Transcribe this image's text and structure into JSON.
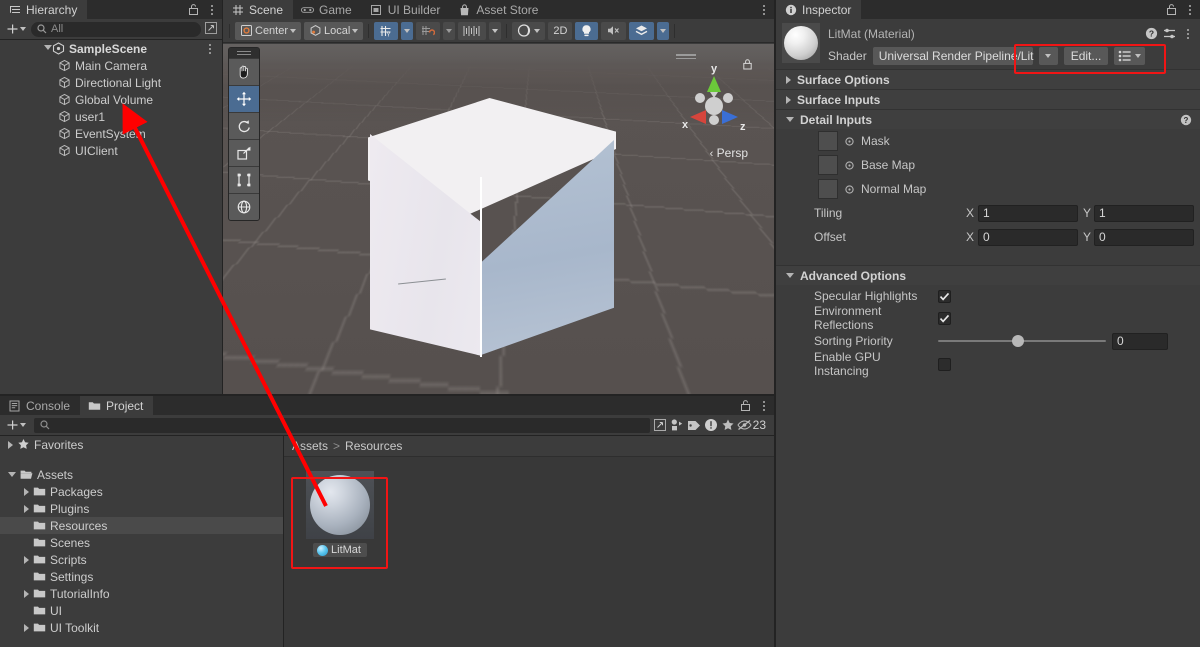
{
  "app": {
    "name": "Unity Editor"
  },
  "hierarchy": {
    "tab_label": "Hierarchy",
    "tab_icon": "hierarchy-icon",
    "add_label": "+",
    "search_placeholder": "All",
    "search_value": "",
    "scene_name": "SampleScene",
    "items": [
      {
        "label": "Main Camera",
        "icon": "gameobject-icon"
      },
      {
        "label": "Directional Light",
        "icon": "gameobject-icon"
      },
      {
        "label": "Global Volume",
        "icon": "gameobject-icon"
      },
      {
        "label": "user1",
        "icon": "gameobject-icon"
      },
      {
        "label": "EventSystem",
        "icon": "gameobject-icon"
      },
      {
        "label": "UIClient",
        "icon": "gameobject-icon"
      }
    ]
  },
  "scene": {
    "tabs": [
      {
        "label": "Scene",
        "icon": "scene-grid-icon",
        "active": true
      },
      {
        "label": "Game",
        "icon": "gamepad-icon",
        "active": false
      },
      {
        "label": "UI Builder",
        "icon": "ui-builder-icon",
        "active": false
      },
      {
        "label": "Asset Store",
        "icon": "store-bag-icon",
        "active": false
      }
    ],
    "toolbar": {
      "pivot_label": "Center",
      "handle_label": "Local",
      "grid_snap_icon": "grid-snap-icon",
      "magnet_icon": "magnet-snap-icon",
      "ruler_icon": "grid-ruler-icon",
      "shading_icon": "shading-mode-icon",
      "view2d_label": "2D",
      "lighting_icon": "lightbulb-icon",
      "audio_icon": "audio-mute-icon",
      "fx_icon": "effects-icon"
    },
    "tools": [
      {
        "name": "hand-tool",
        "selected": false
      },
      {
        "name": "move-tool",
        "selected": true
      },
      {
        "name": "rotate-tool",
        "selected": false
      },
      {
        "name": "scale-tool",
        "selected": false
      },
      {
        "name": "rect-tool",
        "selected": false
      },
      {
        "name": "transform-tool",
        "selected": false
      }
    ],
    "gizmo": {
      "perspective_label": "Persp",
      "axis_x": "x",
      "axis_y": "y",
      "axis_z": "z",
      "color_x": "#d6453c",
      "color_y": "#6bc93a",
      "color_z": "#3a6fd6"
    }
  },
  "project": {
    "tabs": [
      {
        "label": "Console",
        "icon": "console-icon",
        "active": false
      },
      {
        "label": "Project",
        "icon": "folder-icon",
        "active": true
      }
    ],
    "add_label": "+",
    "search_placeholder": "",
    "search_value": "",
    "filters": [
      {
        "name": "save-search-icon"
      },
      {
        "name": "asset-type-filter-icon"
      },
      {
        "name": "label-filter-icon"
      },
      {
        "name": "warning-filter-icon"
      },
      {
        "name": "favorite-filter-icon"
      }
    ],
    "hidden_count": "23",
    "hidden_count_icon": "hidden-eye-icon",
    "tree": [
      {
        "label": "Favorites",
        "icon": "star-icon",
        "depth": 0,
        "expandable": true,
        "expanded": false,
        "selected": false
      },
      {
        "label": "Assets",
        "icon": "open-folder-icon",
        "depth": 0,
        "expandable": true,
        "expanded": true,
        "selected": false
      },
      {
        "label": "Packages",
        "icon": "folder-icon",
        "depth": 1,
        "expandable": true,
        "expanded": false,
        "selected": false
      },
      {
        "label": "Plugins",
        "icon": "folder-icon",
        "depth": 1,
        "expandable": true,
        "expanded": false,
        "selected": false
      },
      {
        "label": "Resources",
        "icon": "folder-icon",
        "depth": 1,
        "expandable": false,
        "expanded": false,
        "selected": true
      },
      {
        "label": "Scenes",
        "icon": "folder-icon",
        "depth": 1,
        "expandable": false,
        "expanded": false,
        "selected": false
      },
      {
        "label": "Scripts",
        "icon": "folder-icon",
        "depth": 1,
        "expandable": true,
        "expanded": false,
        "selected": false
      },
      {
        "label": "Settings",
        "icon": "folder-icon",
        "depth": 1,
        "expandable": false,
        "expanded": false,
        "selected": false
      },
      {
        "label": "TutorialInfo",
        "icon": "folder-icon",
        "depth": 1,
        "expandable": true,
        "expanded": false,
        "selected": false
      },
      {
        "label": "UI",
        "icon": "folder-icon",
        "depth": 1,
        "expandable": false,
        "expanded": false,
        "selected": false
      },
      {
        "label": "UI Toolkit",
        "icon": "folder-icon",
        "depth": 1,
        "expandable": true,
        "expanded": false,
        "selected": false
      }
    ],
    "breadcrumb": [
      "Assets",
      "Resources"
    ],
    "breadcrumb_sep": ">",
    "assets": [
      {
        "label": "LitMat",
        "icon": "material-sphere-icon",
        "selected": true
      }
    ]
  },
  "inspector": {
    "tab_label": "Inspector",
    "tab_icon": "info-icon",
    "object_title": "LitMat (Material)",
    "preview_icon": "material-preview-sphere",
    "header_icons": [
      "help-icon",
      "preset-icon",
      "kebab-icon"
    ],
    "shader": {
      "label": "Shader",
      "value": "Universal Render Pipeline/Lit",
      "edit_label": "Edit...",
      "preset_icon": "shader-preset-icon"
    },
    "sections": [
      {
        "title": "Surface Options",
        "expanded": false
      },
      {
        "title": "Surface Inputs",
        "expanded": false
      },
      {
        "title": "Detail Inputs",
        "expanded": true,
        "help": true
      }
    ],
    "detail_inputs": {
      "textures": [
        {
          "label": "Mask"
        },
        {
          "label": "Base Map"
        },
        {
          "label": "Normal Map"
        }
      ],
      "tiling": {
        "label": "Tiling",
        "x_label": "X",
        "x": "1",
        "y_label": "Y",
        "y": "1"
      },
      "offset": {
        "label": "Offset",
        "x_label": "X",
        "x": "0",
        "y_label": "Y",
        "y": "0"
      }
    },
    "advanced": {
      "title": "Advanced Options",
      "expanded": true,
      "specular_highlights": {
        "label": "Specular Highlights",
        "checked": true
      },
      "environment_reflections": {
        "label": "Environment Reflections",
        "checked": true
      },
      "sorting_priority": {
        "label": "Sorting Priority",
        "value": "0",
        "percent": 50
      },
      "gpu_instancing": {
        "label": "Enable GPU Instancing",
        "checked": false
      }
    }
  },
  "annotation": {
    "arrow_color": "#ff0000",
    "highlight_color": "#f11515",
    "arrow_from": "LitMat asset thumbnail",
    "arrow_to": "user1 hierarchy object"
  }
}
